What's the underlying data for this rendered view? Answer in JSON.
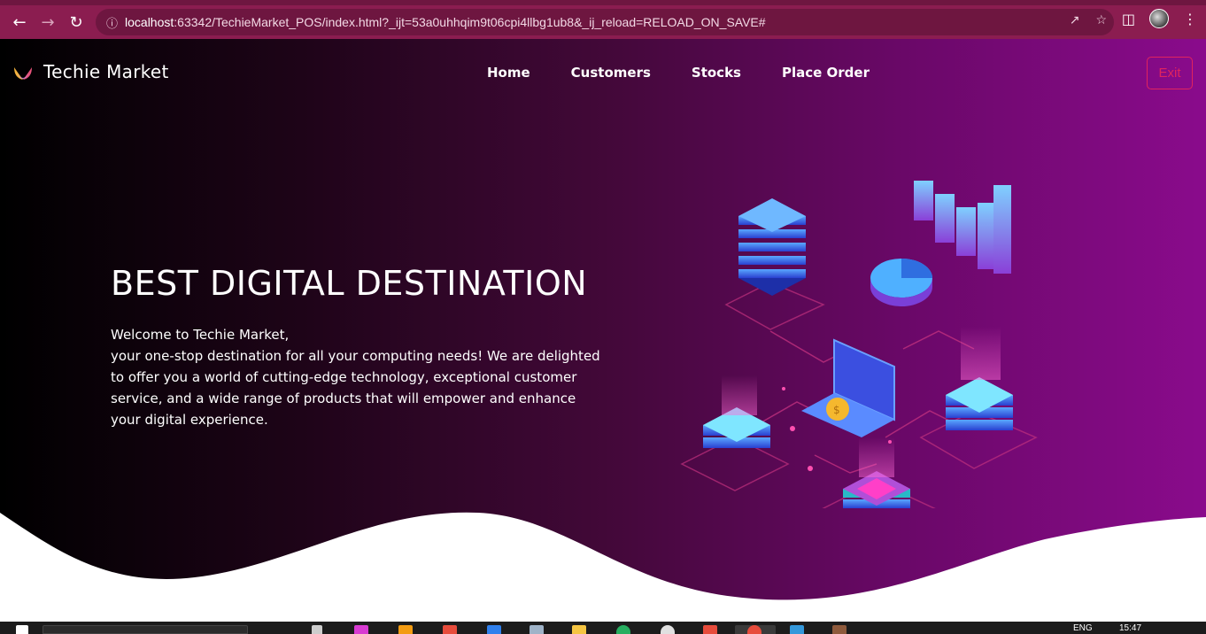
{
  "browser": {
    "url_host": "localhost",
    "url_rest": ":63342/TechieMarket_POS/index.html?_ijt=53a0uhhqim9t06cpi4llbg1ub8&_ij_reload=RELOAD_ON_SAVE#",
    "icons": [
      "back-icon",
      "forward-icon",
      "reload-icon",
      "info-icon",
      "share-icon",
      "star-icon",
      "sidebar-icon",
      "profile-icon",
      "menu-icon"
    ]
  },
  "header": {
    "brand": "Techie Market",
    "menu": [
      {
        "label": "Home"
      },
      {
        "label": "Customers"
      },
      {
        "label": "Stocks"
      },
      {
        "label": "Place Order"
      }
    ],
    "exit_label": "Exit"
  },
  "hero": {
    "title": "BEST DIGITAL DESTINATION",
    "line1": "Welcome to Techie Market,",
    "line2": "your one-stop destination for all your computing needs! We are delighted to offer you a world of cutting-edge technology, exceptional customer service, and a wide range of products that will empower and enhance your digital experience."
  },
  "taskbar": {
    "language": "ENG",
    "time": "15:47"
  },
  "colors": {
    "browser_bar": "#8b1d50",
    "gradient_start": "#000000",
    "gradient_end": "#8a0b8c",
    "exit_accent": "#e0245e"
  }
}
